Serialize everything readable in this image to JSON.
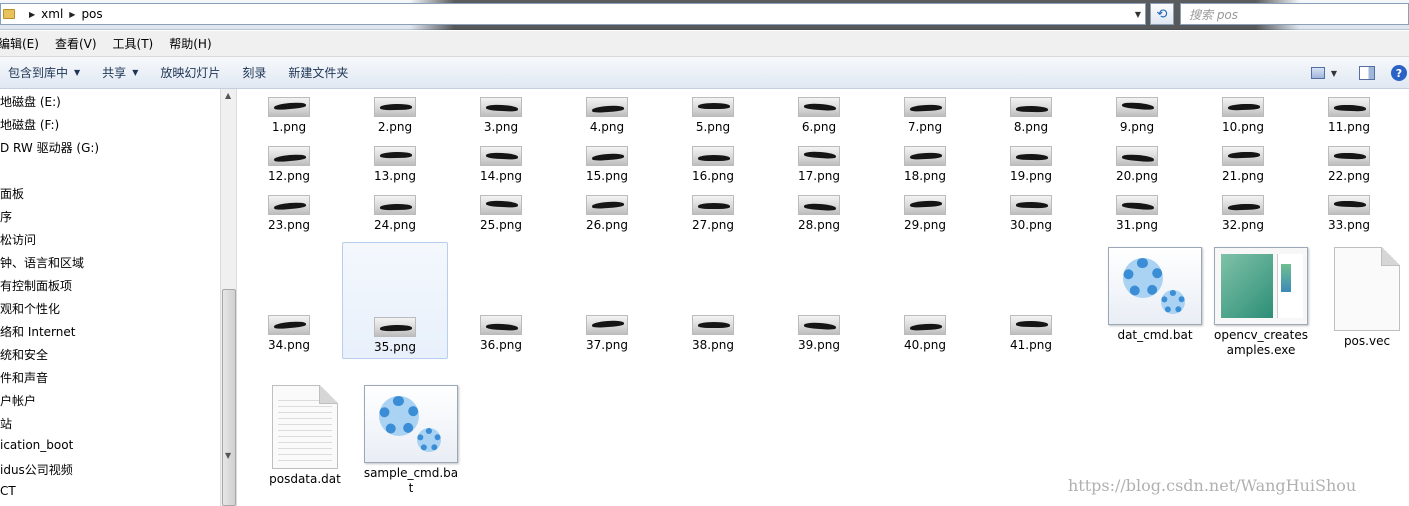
{
  "address": {
    "crumbs": [
      "xml",
      "pos"
    ],
    "search_placeholder": "搜索 pos"
  },
  "menu": [
    "编辑(E)",
    "查看(V)",
    "工具(T)",
    "帮助(H)"
  ],
  "toolbar": {
    "include_library": "包含到库中",
    "share": "共享",
    "slideshow": "放映幻灯片",
    "burn": "刻录",
    "new_folder": "新建文件夹"
  },
  "sidebar": [
    "地磁盘 (E:)",
    "地磁盘 (F:)",
    "D RW 驱动器 (G:)",
    "",
    "面板",
    "序",
    "松访问",
    "钟、语言和区域",
    "有控制面板项",
    "观和个性化",
    "络和 Internet",
    "统和安全",
    "件和声音",
    "户帐户",
    "站",
    "ication_boot",
    "idus公司视频",
    "CT"
  ],
  "files": {
    "images": [
      "1.png",
      "2.png",
      "3.png",
      "4.png",
      "5.png",
      "6.png",
      "7.png",
      "8.png",
      "9.png",
      "10.png",
      "11.png",
      "12.png",
      "13.png",
      "14.png",
      "15.png",
      "16.png",
      "17.png",
      "18.png",
      "19.png",
      "20.png",
      "21.png",
      "22.png",
      "23.png",
      "24.png",
      "25.png",
      "26.png",
      "27.png",
      "28.png",
      "29.png",
      "30.png",
      "31.png",
      "32.png",
      "33.png",
      "34.png",
      "35.png",
      "36.png",
      "37.png",
      "38.png",
      "39.png",
      "40.png",
      "41.png"
    ],
    "selected": "35.png",
    "dat_cmd": "dat_cmd.bat",
    "opencv": "opencv_createsamples.exe",
    "pos_vec": "pos.vec",
    "posdata": "posdata.dat",
    "sample_cmd": "sample_cmd.bat"
  },
  "watermark": "https://blog.csdn.net/WangHuiShou"
}
